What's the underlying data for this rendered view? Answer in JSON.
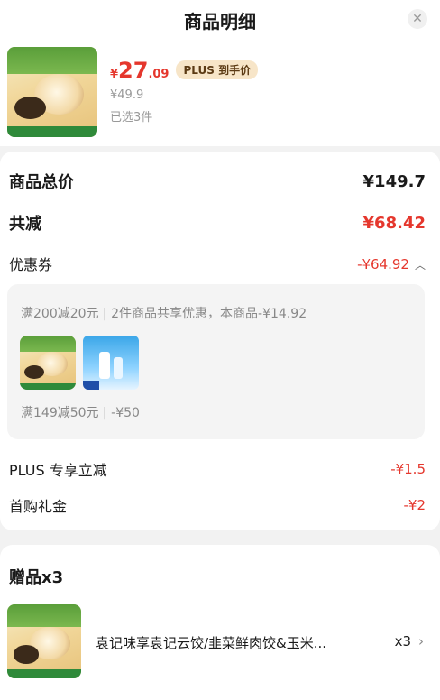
{
  "header": {
    "title": "商品明细",
    "close_glyph": "✕"
  },
  "product": {
    "price_symbol": "¥",
    "price_int": "27",
    "price_dec": ".09",
    "plus_label": "PLUS 到手价",
    "original_price": "¥49.9",
    "selected_count": "已选3件",
    "image_icon": "dumpling-product-image"
  },
  "summary": {
    "total_label": "商品总价",
    "total_value": "¥149.7",
    "discount_label": "共减",
    "discount_value": "¥68.42",
    "coupon_label": "优惠券",
    "coupon_value": "-¥64.92",
    "coupon_rule1": "满200减20元 | 2件商品共享优惠，本商品-¥14.92",
    "coupon_rule2": "满149减50元 | -¥50",
    "plus_label": "PLUS 专享立减",
    "plus_value": "-¥1.5",
    "first_label": "首购礼金",
    "first_value": "-¥2"
  },
  "gift": {
    "title": "赠品x3",
    "name": "袁记味享袁记云饺/韭菜鲜肉饺&玉米...",
    "qty": "x3"
  },
  "colors": {
    "accent_red": "#e5372d",
    "plus_badge_bg": "#f7e5c8"
  }
}
